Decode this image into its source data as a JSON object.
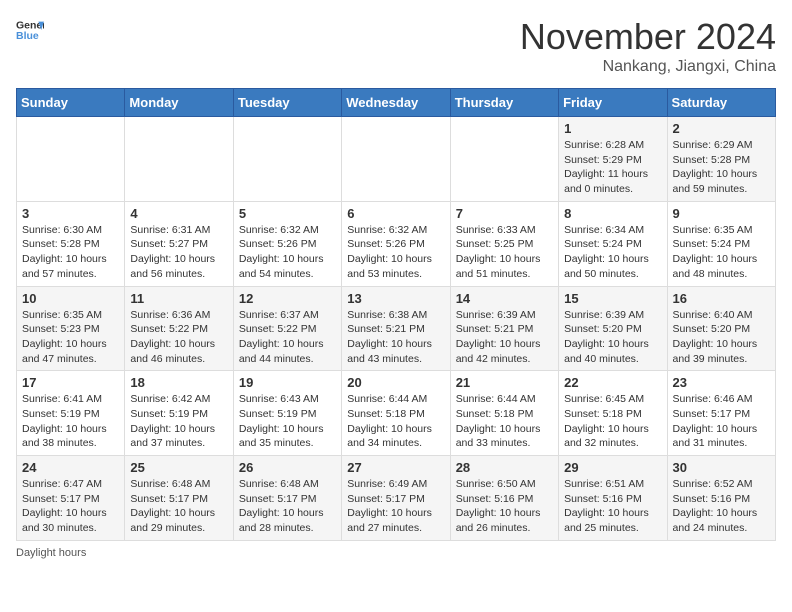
{
  "header": {
    "logo_general": "General",
    "logo_blue": "Blue",
    "month": "November 2024",
    "location": "Nankang, Jiangxi, China"
  },
  "weekdays": [
    "Sunday",
    "Monday",
    "Tuesday",
    "Wednesday",
    "Thursday",
    "Friday",
    "Saturday"
  ],
  "weeks": [
    [
      {
        "day": "",
        "info": ""
      },
      {
        "day": "",
        "info": ""
      },
      {
        "day": "",
        "info": ""
      },
      {
        "day": "",
        "info": ""
      },
      {
        "day": "",
        "info": ""
      },
      {
        "day": "1",
        "info": "Sunrise: 6:28 AM\nSunset: 5:29 PM\nDaylight: 11 hours and 0 minutes."
      },
      {
        "day": "2",
        "info": "Sunrise: 6:29 AM\nSunset: 5:28 PM\nDaylight: 10 hours and 59 minutes."
      }
    ],
    [
      {
        "day": "3",
        "info": "Sunrise: 6:30 AM\nSunset: 5:28 PM\nDaylight: 10 hours and 57 minutes."
      },
      {
        "day": "4",
        "info": "Sunrise: 6:31 AM\nSunset: 5:27 PM\nDaylight: 10 hours and 56 minutes."
      },
      {
        "day": "5",
        "info": "Sunrise: 6:32 AM\nSunset: 5:26 PM\nDaylight: 10 hours and 54 minutes."
      },
      {
        "day": "6",
        "info": "Sunrise: 6:32 AM\nSunset: 5:26 PM\nDaylight: 10 hours and 53 minutes."
      },
      {
        "day": "7",
        "info": "Sunrise: 6:33 AM\nSunset: 5:25 PM\nDaylight: 10 hours and 51 minutes."
      },
      {
        "day": "8",
        "info": "Sunrise: 6:34 AM\nSunset: 5:24 PM\nDaylight: 10 hours and 50 minutes."
      },
      {
        "day": "9",
        "info": "Sunrise: 6:35 AM\nSunset: 5:24 PM\nDaylight: 10 hours and 48 minutes."
      }
    ],
    [
      {
        "day": "10",
        "info": "Sunrise: 6:35 AM\nSunset: 5:23 PM\nDaylight: 10 hours and 47 minutes."
      },
      {
        "day": "11",
        "info": "Sunrise: 6:36 AM\nSunset: 5:22 PM\nDaylight: 10 hours and 46 minutes."
      },
      {
        "day": "12",
        "info": "Sunrise: 6:37 AM\nSunset: 5:22 PM\nDaylight: 10 hours and 44 minutes."
      },
      {
        "day": "13",
        "info": "Sunrise: 6:38 AM\nSunset: 5:21 PM\nDaylight: 10 hours and 43 minutes."
      },
      {
        "day": "14",
        "info": "Sunrise: 6:39 AM\nSunset: 5:21 PM\nDaylight: 10 hours and 42 minutes."
      },
      {
        "day": "15",
        "info": "Sunrise: 6:39 AM\nSunset: 5:20 PM\nDaylight: 10 hours and 40 minutes."
      },
      {
        "day": "16",
        "info": "Sunrise: 6:40 AM\nSunset: 5:20 PM\nDaylight: 10 hours and 39 minutes."
      }
    ],
    [
      {
        "day": "17",
        "info": "Sunrise: 6:41 AM\nSunset: 5:19 PM\nDaylight: 10 hours and 38 minutes."
      },
      {
        "day": "18",
        "info": "Sunrise: 6:42 AM\nSunset: 5:19 PM\nDaylight: 10 hours and 37 minutes."
      },
      {
        "day": "19",
        "info": "Sunrise: 6:43 AM\nSunset: 5:19 PM\nDaylight: 10 hours and 35 minutes."
      },
      {
        "day": "20",
        "info": "Sunrise: 6:44 AM\nSunset: 5:18 PM\nDaylight: 10 hours and 34 minutes."
      },
      {
        "day": "21",
        "info": "Sunrise: 6:44 AM\nSunset: 5:18 PM\nDaylight: 10 hours and 33 minutes."
      },
      {
        "day": "22",
        "info": "Sunrise: 6:45 AM\nSunset: 5:18 PM\nDaylight: 10 hours and 32 minutes."
      },
      {
        "day": "23",
        "info": "Sunrise: 6:46 AM\nSunset: 5:17 PM\nDaylight: 10 hours and 31 minutes."
      }
    ],
    [
      {
        "day": "24",
        "info": "Sunrise: 6:47 AM\nSunset: 5:17 PM\nDaylight: 10 hours and 30 minutes."
      },
      {
        "day": "25",
        "info": "Sunrise: 6:48 AM\nSunset: 5:17 PM\nDaylight: 10 hours and 29 minutes."
      },
      {
        "day": "26",
        "info": "Sunrise: 6:48 AM\nSunset: 5:17 PM\nDaylight: 10 hours and 28 minutes."
      },
      {
        "day": "27",
        "info": "Sunrise: 6:49 AM\nSunset: 5:17 PM\nDaylight: 10 hours and 27 minutes."
      },
      {
        "day": "28",
        "info": "Sunrise: 6:50 AM\nSunset: 5:16 PM\nDaylight: 10 hours and 26 minutes."
      },
      {
        "day": "29",
        "info": "Sunrise: 6:51 AM\nSunset: 5:16 PM\nDaylight: 10 hours and 25 minutes."
      },
      {
        "day": "30",
        "info": "Sunrise: 6:52 AM\nSunset: 5:16 PM\nDaylight: 10 hours and 24 minutes."
      }
    ]
  ],
  "footer": {
    "daylight_label": "Daylight hours"
  }
}
